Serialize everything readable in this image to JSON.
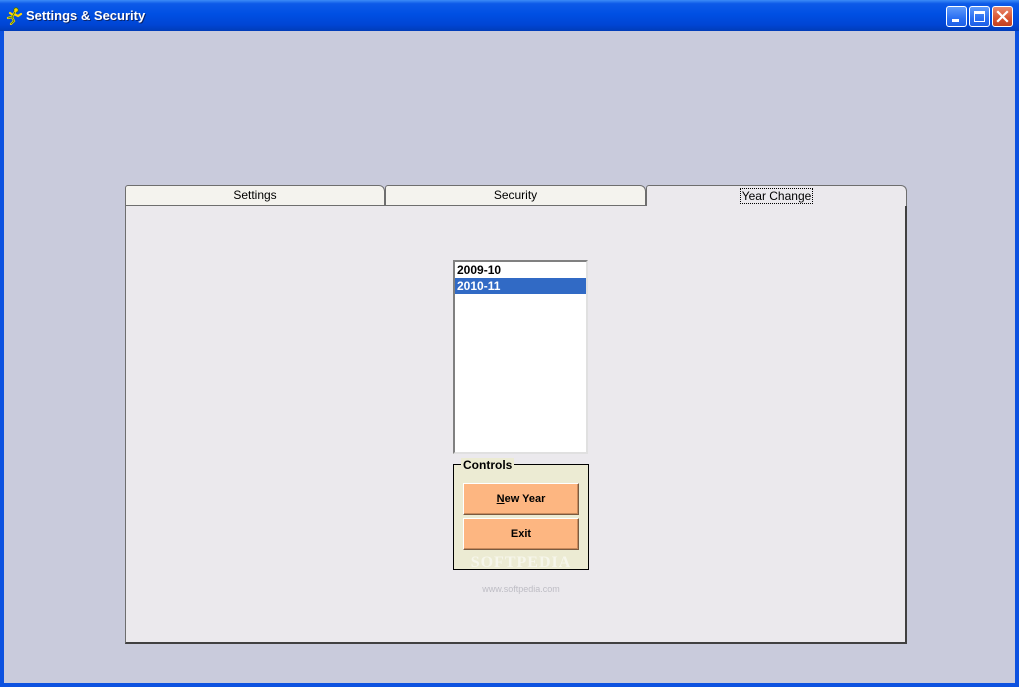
{
  "window": {
    "title": "Settings & Security",
    "icon": "running-man-icon"
  },
  "controls": {
    "minimize": "minimize-icon",
    "maximize": "maximize-icon",
    "close": "close-icon"
  },
  "tabs": [
    {
      "label": "Settings",
      "active": false
    },
    {
      "label": "Security",
      "active": false
    },
    {
      "label": "Year Change",
      "active": true
    }
  ],
  "year_list": {
    "items": [
      "2009-10",
      "2010-11"
    ],
    "selected": "2010-11"
  },
  "controls_group": {
    "legend": "Controls",
    "new_year_prefix": "N",
    "new_year_rest": "ew Year",
    "exit_label": "Exit"
  },
  "watermark": {
    "text": "SOFTPEDIA",
    "url": "www.softpedia.com"
  },
  "colors": {
    "titlebar": "#0050e3",
    "background": "#c9cbdc",
    "panel": "#ebe9ed",
    "selection": "#316ac5",
    "button": "#fdb681",
    "groupbox": "#ecebd3"
  }
}
